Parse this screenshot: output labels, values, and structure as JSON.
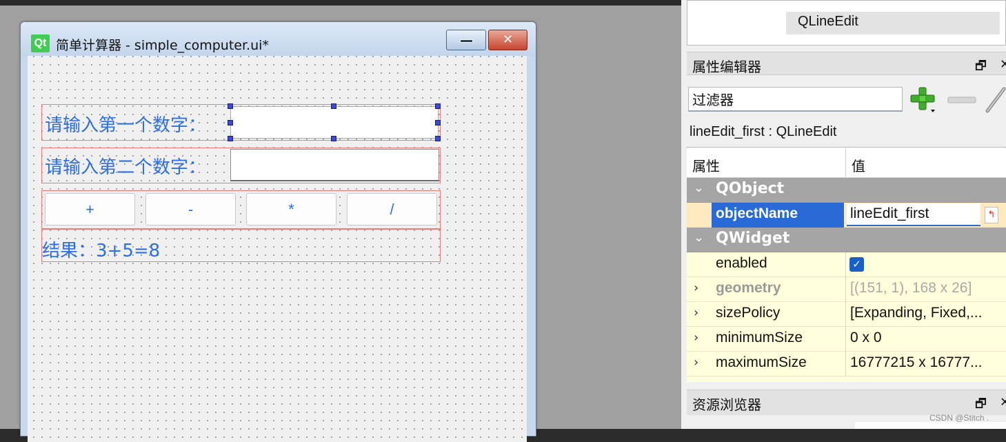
{
  "form_window": {
    "logo_text": "Qt",
    "title": "简单计算器 - simple_computer.ui*",
    "minimize_label": "",
    "close_label": "✕",
    "label_first": "请输入第一个数字：",
    "label_second": "请输入第二个数字：",
    "buttons": [
      "+",
      "-",
      "*",
      "/"
    ],
    "result": "结果：3+5=8"
  },
  "object_inspector": {
    "selected_item": "QLineEdit"
  },
  "property_editor": {
    "title": "属性编辑器",
    "filter_value": "过滤器",
    "current_object": "lineEdit_first : QLineEdit",
    "header_property": "属性",
    "header_value": "值",
    "group_qobject": "QObject",
    "group_qwidget": "QWidget",
    "rows": {
      "objectName": {
        "name": "objectName",
        "value": "lineEdit_first"
      },
      "enabled": {
        "name": "enabled",
        "value": "✓"
      },
      "geometry": {
        "name": "geometry",
        "value": "[(151, 1), 168 x 26]"
      },
      "sizePolicy": {
        "name": "sizePolicy",
        "value": "[Expanding, Fixed,..."
      },
      "minimumSize": {
        "name": "minimumSize",
        "value": "0 x 0"
      },
      "maximumSize": {
        "name": "maximumSize",
        "value": "16777215 x 16777..."
      }
    }
  },
  "resource_browser": {
    "title": "资源浏览器"
  },
  "dock_float_glyph": "🗗",
  "dock_close_glyph": "✕",
  "watermark": "CSDN @Stitch ."
}
